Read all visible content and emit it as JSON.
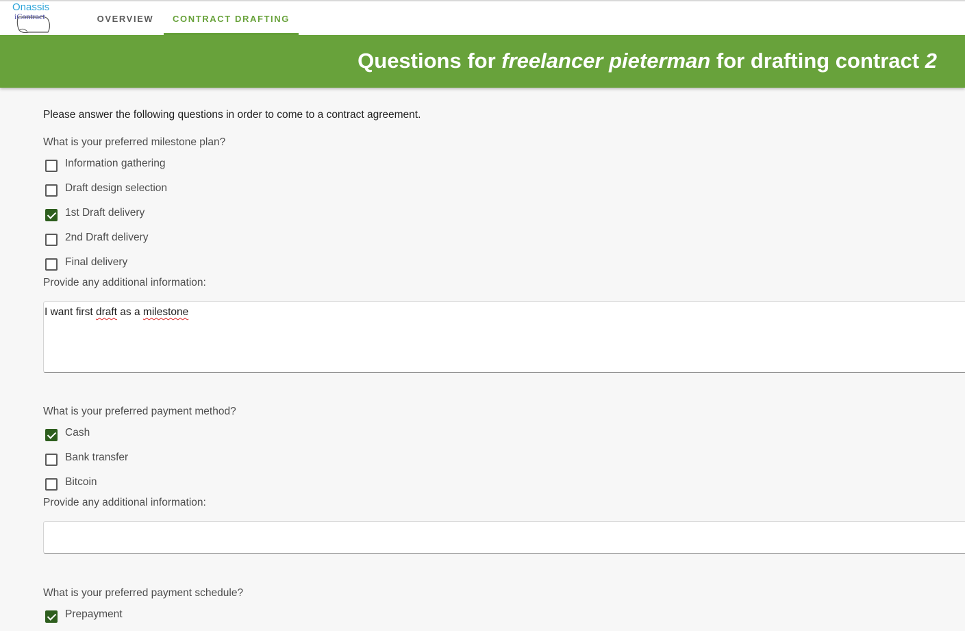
{
  "header": {
    "logo": {
      "line1": "Onassis",
      "line2": "iContract"
    },
    "tabs": [
      {
        "label": "OVERVIEW",
        "active": false
      },
      {
        "label": "CONTRACT DRAFTING",
        "active": true
      }
    ],
    "accent_color": "#68a23b"
  },
  "banner": {
    "prefix": "Questions for",
    "freelancer": "freelancer pieterman",
    "middle": "for drafting contract",
    "contract_number": "2"
  },
  "intro": "Please answer the following questions in order to come to a contract agreement.",
  "questions": [
    {
      "question": "What is your preferred milestone plan?",
      "options": [
        {
          "label": "Information gathering",
          "checked": false
        },
        {
          "label": "Draft design selection",
          "checked": false
        },
        {
          "label": "1st Draft delivery",
          "checked": true
        },
        {
          "label": "2nd Draft delivery",
          "checked": false
        },
        {
          "label": "Final delivery",
          "checked": false
        }
      ],
      "info_label": "Provide any additional information:",
      "info_value": {
        "w1": "I want first",
        "w2": "draft",
        "w3": "as a",
        "w4": "milestone"
      }
    },
    {
      "question": "What is your preferred payment method?",
      "options": [
        {
          "label": "Cash",
          "checked": true
        },
        {
          "label": "Bank transfer",
          "checked": false
        },
        {
          "label": "Bitcoin",
          "checked": false
        }
      ],
      "info_label": "Provide any additional information:",
      "info_value": ""
    },
    {
      "question": "What is your preferred payment schedule?",
      "options": [
        {
          "label": "Prepayment",
          "checked": true
        }
      ]
    }
  ]
}
